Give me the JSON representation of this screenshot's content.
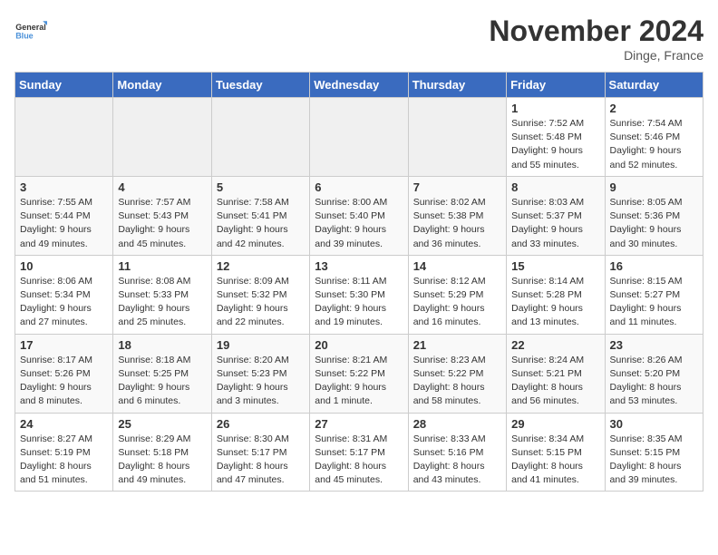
{
  "logo": {
    "general": "General",
    "blue": "Blue"
  },
  "title": "November 2024",
  "location": "Dinge, France",
  "days_header": [
    "Sunday",
    "Monday",
    "Tuesday",
    "Wednesday",
    "Thursday",
    "Friday",
    "Saturday"
  ],
  "weeks": [
    [
      {
        "day": "",
        "info": "",
        "empty": true
      },
      {
        "day": "",
        "info": "",
        "empty": true
      },
      {
        "day": "",
        "info": "",
        "empty": true
      },
      {
        "day": "",
        "info": "",
        "empty": true
      },
      {
        "day": "",
        "info": "",
        "empty": true
      },
      {
        "day": "1",
        "info": "Sunrise: 7:52 AM\nSunset: 5:48 PM\nDaylight: 9 hours and 55 minutes."
      },
      {
        "day": "2",
        "info": "Sunrise: 7:54 AM\nSunset: 5:46 PM\nDaylight: 9 hours and 52 minutes."
      }
    ],
    [
      {
        "day": "3",
        "info": "Sunrise: 7:55 AM\nSunset: 5:44 PM\nDaylight: 9 hours and 49 minutes."
      },
      {
        "day": "4",
        "info": "Sunrise: 7:57 AM\nSunset: 5:43 PM\nDaylight: 9 hours and 45 minutes."
      },
      {
        "day": "5",
        "info": "Sunrise: 7:58 AM\nSunset: 5:41 PM\nDaylight: 9 hours and 42 minutes."
      },
      {
        "day": "6",
        "info": "Sunrise: 8:00 AM\nSunset: 5:40 PM\nDaylight: 9 hours and 39 minutes."
      },
      {
        "day": "7",
        "info": "Sunrise: 8:02 AM\nSunset: 5:38 PM\nDaylight: 9 hours and 36 minutes."
      },
      {
        "day": "8",
        "info": "Sunrise: 8:03 AM\nSunset: 5:37 PM\nDaylight: 9 hours and 33 minutes."
      },
      {
        "day": "9",
        "info": "Sunrise: 8:05 AM\nSunset: 5:36 PM\nDaylight: 9 hours and 30 minutes."
      }
    ],
    [
      {
        "day": "10",
        "info": "Sunrise: 8:06 AM\nSunset: 5:34 PM\nDaylight: 9 hours and 27 minutes."
      },
      {
        "day": "11",
        "info": "Sunrise: 8:08 AM\nSunset: 5:33 PM\nDaylight: 9 hours and 25 minutes."
      },
      {
        "day": "12",
        "info": "Sunrise: 8:09 AM\nSunset: 5:32 PM\nDaylight: 9 hours and 22 minutes."
      },
      {
        "day": "13",
        "info": "Sunrise: 8:11 AM\nSunset: 5:30 PM\nDaylight: 9 hours and 19 minutes."
      },
      {
        "day": "14",
        "info": "Sunrise: 8:12 AM\nSunset: 5:29 PM\nDaylight: 9 hours and 16 minutes."
      },
      {
        "day": "15",
        "info": "Sunrise: 8:14 AM\nSunset: 5:28 PM\nDaylight: 9 hours and 13 minutes."
      },
      {
        "day": "16",
        "info": "Sunrise: 8:15 AM\nSunset: 5:27 PM\nDaylight: 9 hours and 11 minutes."
      }
    ],
    [
      {
        "day": "17",
        "info": "Sunrise: 8:17 AM\nSunset: 5:26 PM\nDaylight: 9 hours and 8 minutes."
      },
      {
        "day": "18",
        "info": "Sunrise: 8:18 AM\nSunset: 5:25 PM\nDaylight: 9 hours and 6 minutes."
      },
      {
        "day": "19",
        "info": "Sunrise: 8:20 AM\nSunset: 5:23 PM\nDaylight: 9 hours and 3 minutes."
      },
      {
        "day": "20",
        "info": "Sunrise: 8:21 AM\nSunset: 5:22 PM\nDaylight: 9 hours and 1 minute."
      },
      {
        "day": "21",
        "info": "Sunrise: 8:23 AM\nSunset: 5:22 PM\nDaylight: 8 hours and 58 minutes."
      },
      {
        "day": "22",
        "info": "Sunrise: 8:24 AM\nSunset: 5:21 PM\nDaylight: 8 hours and 56 minutes."
      },
      {
        "day": "23",
        "info": "Sunrise: 8:26 AM\nSunset: 5:20 PM\nDaylight: 8 hours and 53 minutes."
      }
    ],
    [
      {
        "day": "24",
        "info": "Sunrise: 8:27 AM\nSunset: 5:19 PM\nDaylight: 8 hours and 51 minutes."
      },
      {
        "day": "25",
        "info": "Sunrise: 8:29 AM\nSunset: 5:18 PM\nDaylight: 8 hours and 49 minutes."
      },
      {
        "day": "26",
        "info": "Sunrise: 8:30 AM\nSunset: 5:17 PM\nDaylight: 8 hours and 47 minutes."
      },
      {
        "day": "27",
        "info": "Sunrise: 8:31 AM\nSunset: 5:17 PM\nDaylight: 8 hours and 45 minutes."
      },
      {
        "day": "28",
        "info": "Sunrise: 8:33 AM\nSunset: 5:16 PM\nDaylight: 8 hours and 43 minutes."
      },
      {
        "day": "29",
        "info": "Sunrise: 8:34 AM\nSunset: 5:15 PM\nDaylight: 8 hours and 41 minutes."
      },
      {
        "day": "30",
        "info": "Sunrise: 8:35 AM\nSunset: 5:15 PM\nDaylight: 8 hours and 39 minutes."
      }
    ]
  ]
}
